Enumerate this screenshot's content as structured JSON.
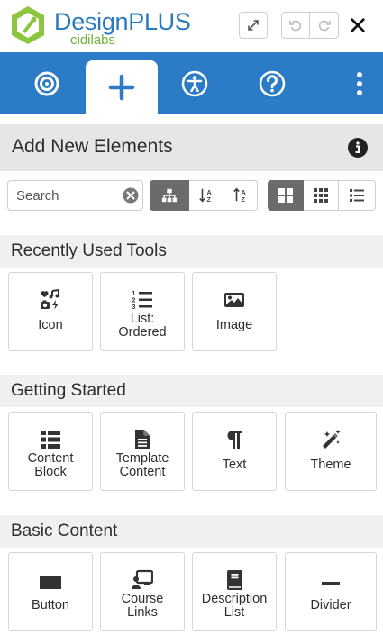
{
  "header": {
    "logo_text": "DesignPLUS",
    "logo_sub": "cidilabs",
    "expand_icon": "expand-arrows-icon",
    "undo_icon": "undo-icon",
    "redo_icon": "redo-icon",
    "close_icon": "close-x-icon"
  },
  "nav": {
    "tabs": [
      {
        "icon": "target-icon",
        "active": false
      },
      {
        "icon": "plus-icon",
        "active": true
      },
      {
        "icon": "accessibility-icon",
        "active": false
      },
      {
        "icon": "help-icon",
        "active": false
      },
      {
        "icon": "kebab-menu-icon",
        "active": false
      }
    ],
    "color": "#2b7bc7"
  },
  "panel": {
    "title": "Add New Elements",
    "info_icon": "info-icon"
  },
  "toolbar": {
    "search_placeholder": "Search",
    "sort_options": [
      "hierarchy-icon",
      "sort-alpha-down-icon",
      "sort-alpha-up-icon"
    ],
    "active_sort": "hierarchy-icon",
    "view_options": [
      "large-grid-icon",
      "small-grid-icon",
      "list-icon"
    ],
    "active_view": "large-grid-icon"
  },
  "sections": [
    {
      "title": "Recently Used Tools",
      "tools": [
        {
          "label": "Icon",
          "icon": "icons-icon"
        },
        {
          "label": "List: Ordered",
          "icon": "ordered-list-icon"
        },
        {
          "label": "Image",
          "icon": "image-icon"
        }
      ]
    },
    {
      "title": "Getting Started",
      "tools": [
        {
          "label": "Content Block",
          "icon": "content-block-icon"
        },
        {
          "label": "Template Content",
          "icon": "template-file-icon"
        },
        {
          "label": "Text",
          "icon": "paragraph-icon"
        },
        {
          "label": "Theme",
          "icon": "magic-wand-icon"
        }
      ]
    },
    {
      "title": "Basic Content",
      "tools": [
        {
          "label": "Button",
          "icon": "button-icon"
        },
        {
          "label": "Course Links",
          "icon": "course-links-icon"
        },
        {
          "label": "Description List",
          "icon": "book-icon"
        },
        {
          "label": "Divider",
          "icon": "divider-icon"
        }
      ]
    }
  ]
}
